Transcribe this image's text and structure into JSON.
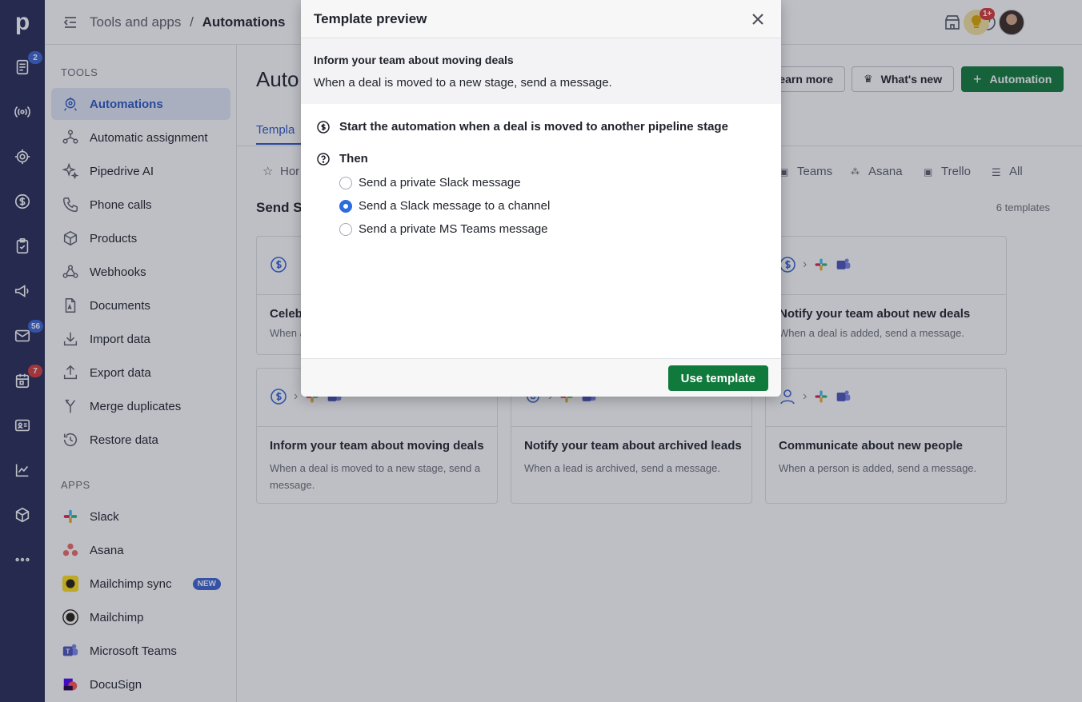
{
  "rail": {
    "logo": "p",
    "items": [
      {
        "name": "leads-icon",
        "badge": "2"
      },
      {
        "name": "broadcast-icon"
      },
      {
        "name": "target-icon"
      },
      {
        "name": "dollar-icon"
      },
      {
        "name": "clipboard-icon"
      },
      {
        "name": "megaphone-icon"
      },
      {
        "name": "mail-icon",
        "badge": "56"
      },
      {
        "name": "calendar-icon",
        "badge": "7"
      },
      {
        "name": "contacts-icon"
      },
      {
        "name": "chart-icon"
      },
      {
        "name": "cube-icon"
      },
      {
        "name": "more-icon"
      }
    ]
  },
  "header": {
    "breadcrumb_parent": "Tools and apps",
    "separator": "/",
    "breadcrumb_current": "Automations",
    "notification_badge": "1+"
  },
  "sidebar": {
    "tools_title": "TOOLS",
    "tools": [
      {
        "label": "Automations",
        "icon": "automation-icon",
        "active": true
      },
      {
        "label": "Automatic assignment",
        "icon": "assignment-icon"
      },
      {
        "label": "Pipedrive AI",
        "icon": "sparkle-icon"
      },
      {
        "label": "Phone calls",
        "icon": "phone-icon"
      },
      {
        "label": "Products",
        "icon": "box-icon"
      },
      {
        "label": "Webhooks",
        "icon": "webhook-icon"
      },
      {
        "label": "Documents",
        "icon": "document-icon"
      },
      {
        "label": "Import data",
        "icon": "import-icon"
      },
      {
        "label": "Export data",
        "icon": "export-icon"
      },
      {
        "label": "Merge duplicates",
        "icon": "merge-icon"
      },
      {
        "label": "Restore data",
        "icon": "restore-icon"
      }
    ],
    "apps_title": "APPS",
    "apps": [
      {
        "label": "Slack",
        "icon": "slack-icon"
      },
      {
        "label": "Asana",
        "icon": "asana-icon"
      },
      {
        "label": "Mailchimp sync",
        "icon": "mailchimp-icon",
        "badge": "NEW"
      },
      {
        "label": "Mailchimp",
        "icon": "mailchimp-icon"
      },
      {
        "label": "Microsoft Teams",
        "icon": "teams-icon"
      },
      {
        "label": "DocuSign",
        "icon": "docusign-icon"
      }
    ]
  },
  "main": {
    "title": "Auto",
    "learn_more": "earn more",
    "whats_new": "What's new",
    "add_automation": "Automation",
    "tab_label": "Templa",
    "filters": {
      "home": "Hor",
      "teams": "Teams",
      "asana": "Asana",
      "trello": "Trello",
      "all": "All"
    },
    "section_title": "Send Sl",
    "template_count": "6 templates",
    "cards": [
      {
        "title": "Celeb",
        "desc": "When a"
      },
      {
        "title": "Notify your team about new deals",
        "desc": "When a deal is added, send a message."
      },
      {
        "title": "Inform your team about moving deals",
        "desc": "When a deal is moved to a new stage, send a message."
      },
      {
        "title": "Notify your team about archived leads",
        "desc": "When a lead is archived, send a message."
      },
      {
        "title": "Communicate about new people",
        "desc": "When a person is added, send a message."
      }
    ]
  },
  "modal": {
    "title": "Template preview",
    "subtitle": "Inform your team about moving deals",
    "description": "When a deal is moved to a new stage, send a message.",
    "trigger": "Start the automation when a deal is moved to another pipeline stage",
    "then_label": "Then",
    "options": [
      {
        "label": "Send a private Slack message",
        "checked": false
      },
      {
        "label": "Send a Slack message to a channel",
        "checked": true
      },
      {
        "label": "Send a private MS Teams message",
        "checked": false
      }
    ],
    "use_button": "Use template"
  },
  "colors": {
    "rail": "#262a56",
    "accent": "#2b57c6",
    "primary_green": "#0f7a3b",
    "radio_blue": "#2b6ce0"
  }
}
